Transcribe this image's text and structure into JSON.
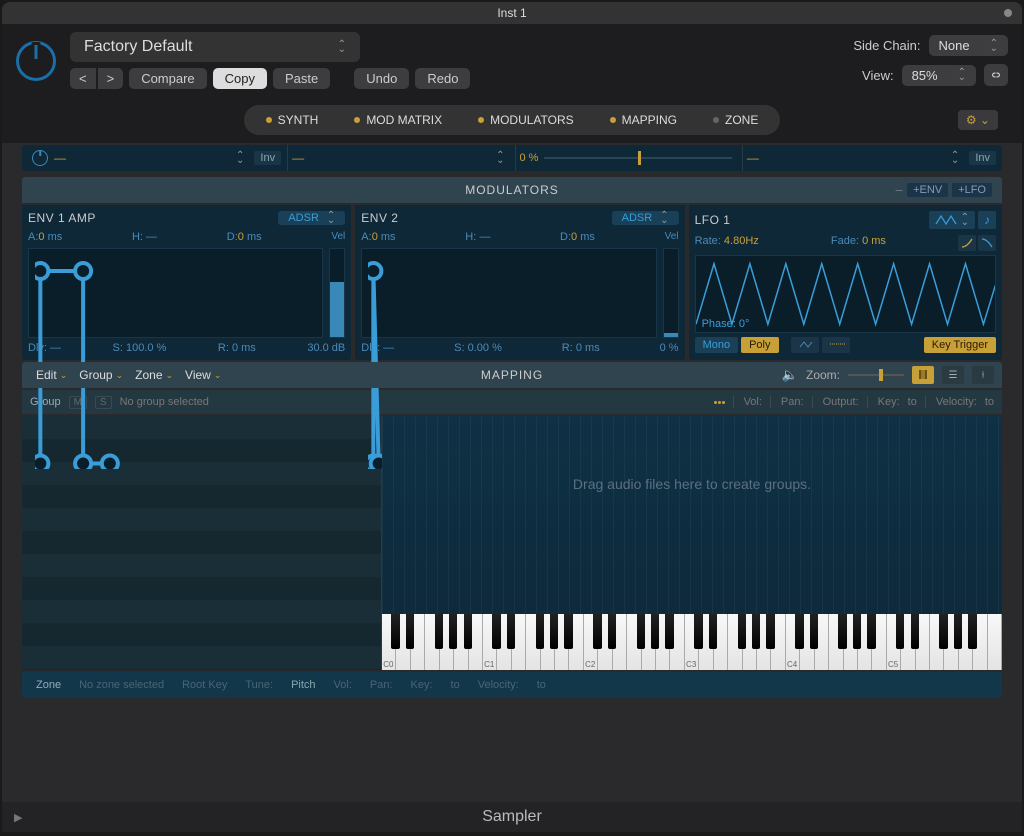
{
  "window": {
    "title": "Inst 1"
  },
  "toolbar": {
    "preset": "Factory Default",
    "compare": "Compare",
    "copy": "Copy",
    "paste": "Paste",
    "undo": "Undo",
    "redo": "Redo",
    "side_chain_label": "Side Chain:",
    "side_chain_value": "None",
    "view_label": "View:",
    "view_value": "85%"
  },
  "tabs": {
    "synth": "SYNTH",
    "mod_matrix": "MOD MATRIX",
    "modulators": "MODULATORS",
    "mapping": "MAPPING",
    "zone": "ZONE"
  },
  "subbar": {
    "inv": "Inv",
    "pct": "0 %"
  },
  "modulators": {
    "title": "MODULATORS",
    "add_env": "+ENV",
    "add_lfo": "+LFO",
    "env1": {
      "title": "ENV 1 AMP",
      "mode": "ADSR",
      "a": "A: 0 ms",
      "h": "H: —",
      "d": "D: 0 ms",
      "vel": "Vel",
      "dly": "Dly: —",
      "s": "S: 100.0 %",
      "r": "R: 0 ms",
      "db": "30.0 dB"
    },
    "env2": {
      "title": "ENV 2",
      "mode": "ADSR",
      "a": "A: 0 ms",
      "h": "H: —",
      "d": "D: 0 ms",
      "vel": "Vel",
      "dly": "Dly: —",
      "s": "S: 0.00 %",
      "r": "R: 0 ms",
      "pct": "0 %"
    },
    "lfo1": {
      "title": "LFO 1",
      "rate_k": "Rate:",
      "rate_v": "4.80Hz",
      "fade_k": "Fade:",
      "fade_v": "0 ms",
      "phase": "Phase: 0°",
      "mono": "Mono",
      "poly": "Poly",
      "key_trigger": "Key Trigger"
    }
  },
  "mapping": {
    "title": "MAPPING",
    "menus": {
      "edit": "Edit",
      "group": "Group",
      "zone": "Zone",
      "view": "View"
    },
    "zoom": "Zoom:",
    "group_bar": {
      "group": "Group",
      "m": "M",
      "s": "S",
      "no_group": "No group selected",
      "vol": "Vol:",
      "pan": "Pan:",
      "output": "Output:",
      "key": "Key:",
      "to1": "to",
      "velocity": "Velocity:",
      "to2": "to"
    },
    "hint": "Drag audio files here to create groups.",
    "zone_bar": {
      "zone": "Zone",
      "no_zone": "No zone selected",
      "root": "Root Key",
      "tune": "Tune:",
      "pitch": "Pitch",
      "vol": "Vol:",
      "pan": "Pan:",
      "key": "Key:",
      "to1": "to",
      "velocity": "Velocity:",
      "to2": "to"
    },
    "octaves": [
      "C0",
      "C1",
      "C2",
      "C3",
      "C4",
      "C5"
    ]
  },
  "footer": {
    "name": "Sampler"
  }
}
